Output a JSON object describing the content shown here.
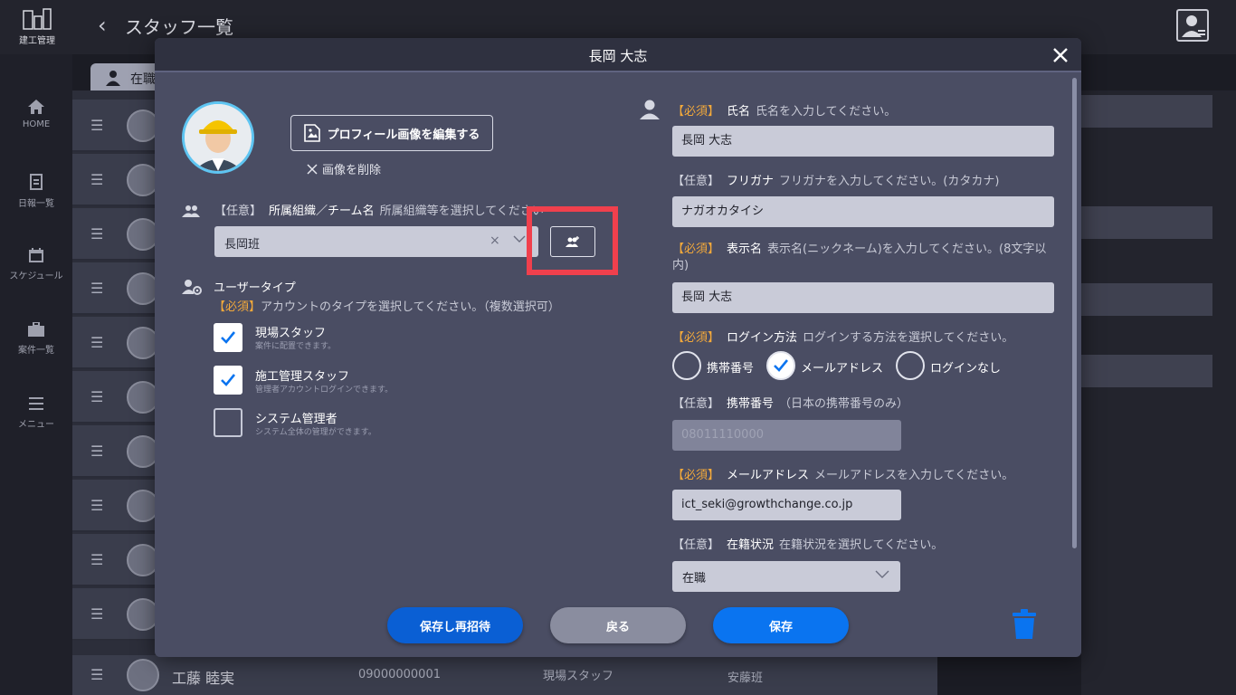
{
  "app": {
    "logo_text": "建工管理",
    "page_title": "スタッフ一覧",
    "nav": [
      {
        "label": "HOME"
      },
      {
        "label": "日報一覧"
      },
      {
        "label": "スケジュール"
      },
      {
        "label": "案件一覧"
      },
      {
        "label": "メニュー"
      }
    ],
    "tab_label": "在職",
    "bottom_row": {
      "name": "工藤 睦実",
      "phone": "09000000001",
      "type": "現場スタッフ",
      "team": "安藤班"
    }
  },
  "modal": {
    "title": "長岡 大志",
    "edit_photo_label": "プロフィール画像を編集する",
    "delete_photo_label": "画像を削除",
    "team": {
      "tag": "【任意】",
      "name": "所属組織／チーム名",
      "hint": "所属組織等を選択してください",
      "value": "長岡班"
    },
    "user_type": {
      "title": "ユーザータイプ",
      "tag": "【必須】",
      "hint": "アカウントのタイプを選択してください。（複数選択可）",
      "options": [
        {
          "label": "現場スタッフ",
          "sub": "案件に配置できます。",
          "checked": true
        },
        {
          "label": "施工管理スタッフ",
          "sub": "管理者アカウントログインできます。",
          "checked": true
        },
        {
          "label": "システム管理者",
          "sub": "システム全体の管理ができます。",
          "checked": false
        }
      ]
    },
    "full_name": {
      "tag": "【必須】",
      "name": "氏名",
      "hint": "氏名を入力してください。",
      "value": "長岡 大志"
    },
    "furigana": {
      "tag": "【任意】",
      "name": "フリガナ",
      "hint": "フリガナを入力してください。(カタカナ)",
      "value": "ナガオカタイシ"
    },
    "display_name": {
      "tag": "【必須】",
      "name": "表示名",
      "hint": "表示名(ニックネーム)を入力してください。(8文字以内)",
      "value": "長岡 大志"
    },
    "login_method": {
      "tag": "【必須】",
      "name": "ログイン方法",
      "hint": "ログインする方法を選択してください。",
      "options": [
        {
          "label": "携帯番号",
          "selected": false
        },
        {
          "label": "メールアドレス",
          "selected": true
        },
        {
          "label": "ログインなし",
          "selected": false
        }
      ]
    },
    "mobile": {
      "tag": "【任意】",
      "name": "携帯番号",
      "hint": "（日本の携帯番号のみ）",
      "value": "08011110000"
    },
    "email": {
      "tag": "【必須】",
      "name": "メールアドレス",
      "hint": "メールアドレスを入力してください。",
      "value": "ict_seki@growthchange.co.jp"
    },
    "status": {
      "tag": "【任意】",
      "name": "在籍状況",
      "hint": "在籍状況を選択してください。",
      "value": "在職"
    },
    "buttons": {
      "reinvite": "保存し再招待",
      "back": "戻る",
      "save": "保存"
    }
  },
  "colors": {
    "required": "#f3a93b",
    "primary_button": "#0a74f0",
    "highlight": "#f0404d"
  }
}
